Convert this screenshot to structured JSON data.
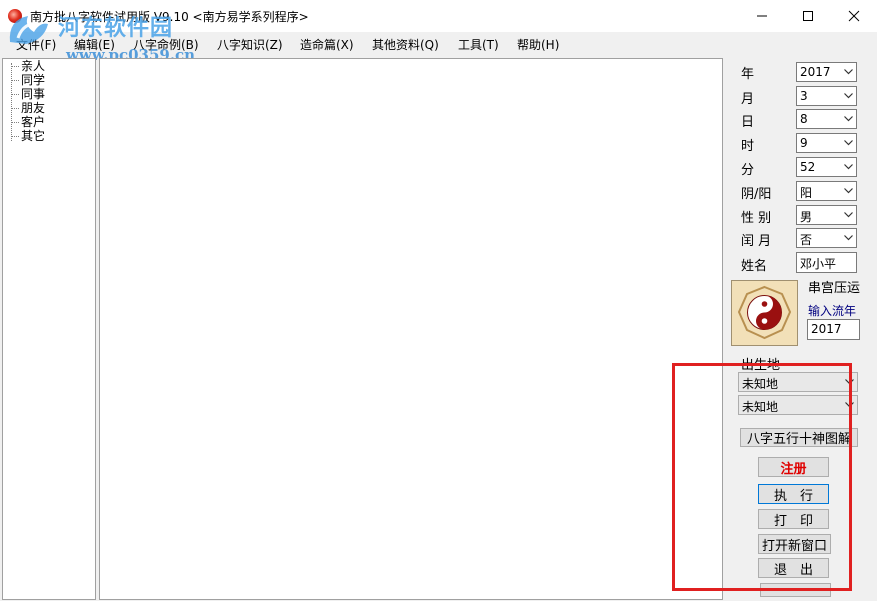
{
  "window": {
    "title": "南方批八字软件试用版 V9.10   <南方易学系列程序>",
    "controls": {
      "minimize_icon": "minimize-icon",
      "maximize_icon": "maximize-icon",
      "close_icon": "close-icon"
    }
  },
  "watermark": {
    "text": "河东软件园",
    "url": "www.pc0359.cn"
  },
  "menu": [
    {
      "label": "文件(F)"
    },
    {
      "label": "编辑(E)"
    },
    {
      "label": "八字命例(B)"
    },
    {
      "label": "八字知识(Z)"
    },
    {
      "label": "造命篇(X)"
    },
    {
      "label": "其他资料(Q)"
    },
    {
      "label": "工具(T)"
    },
    {
      "label": "帮助(H)"
    }
  ],
  "tree": {
    "items": [
      "亲人",
      "同学",
      "同事",
      "朋友",
      "客户",
      "其它"
    ]
  },
  "form": {
    "year": {
      "label": "年",
      "value": "2017"
    },
    "month": {
      "label": "月",
      "value": "3"
    },
    "day": {
      "label": "日",
      "value": "8"
    },
    "hour": {
      "label": "时",
      "value": "9"
    },
    "minute": {
      "label": "分",
      "value": "52"
    },
    "calendar": {
      "label": "阴/阳",
      "value": "阳"
    },
    "gender": {
      "label": "性 别",
      "value": "男"
    },
    "leap": {
      "label": "闰 月",
      "value": "否"
    },
    "name": {
      "label": "姓名",
      "value": "邓小平"
    },
    "palace_label": "串宫压运",
    "flow_year_label": "输入流年",
    "flow_year_value": "2017",
    "birthplace_label": "出生地",
    "birthplace_1": "未知地",
    "birthplace_2": "未知地"
  },
  "buttons": {
    "chart": "八字五行十神图解",
    "register": "注册",
    "execute": "执　行",
    "print": "打　印",
    "new_window": "打开新窗口",
    "exit": "退　出"
  },
  "colors": {
    "accent_red": "#e02020",
    "register_text": "#e00000",
    "flow_year_text": "#000080"
  }
}
